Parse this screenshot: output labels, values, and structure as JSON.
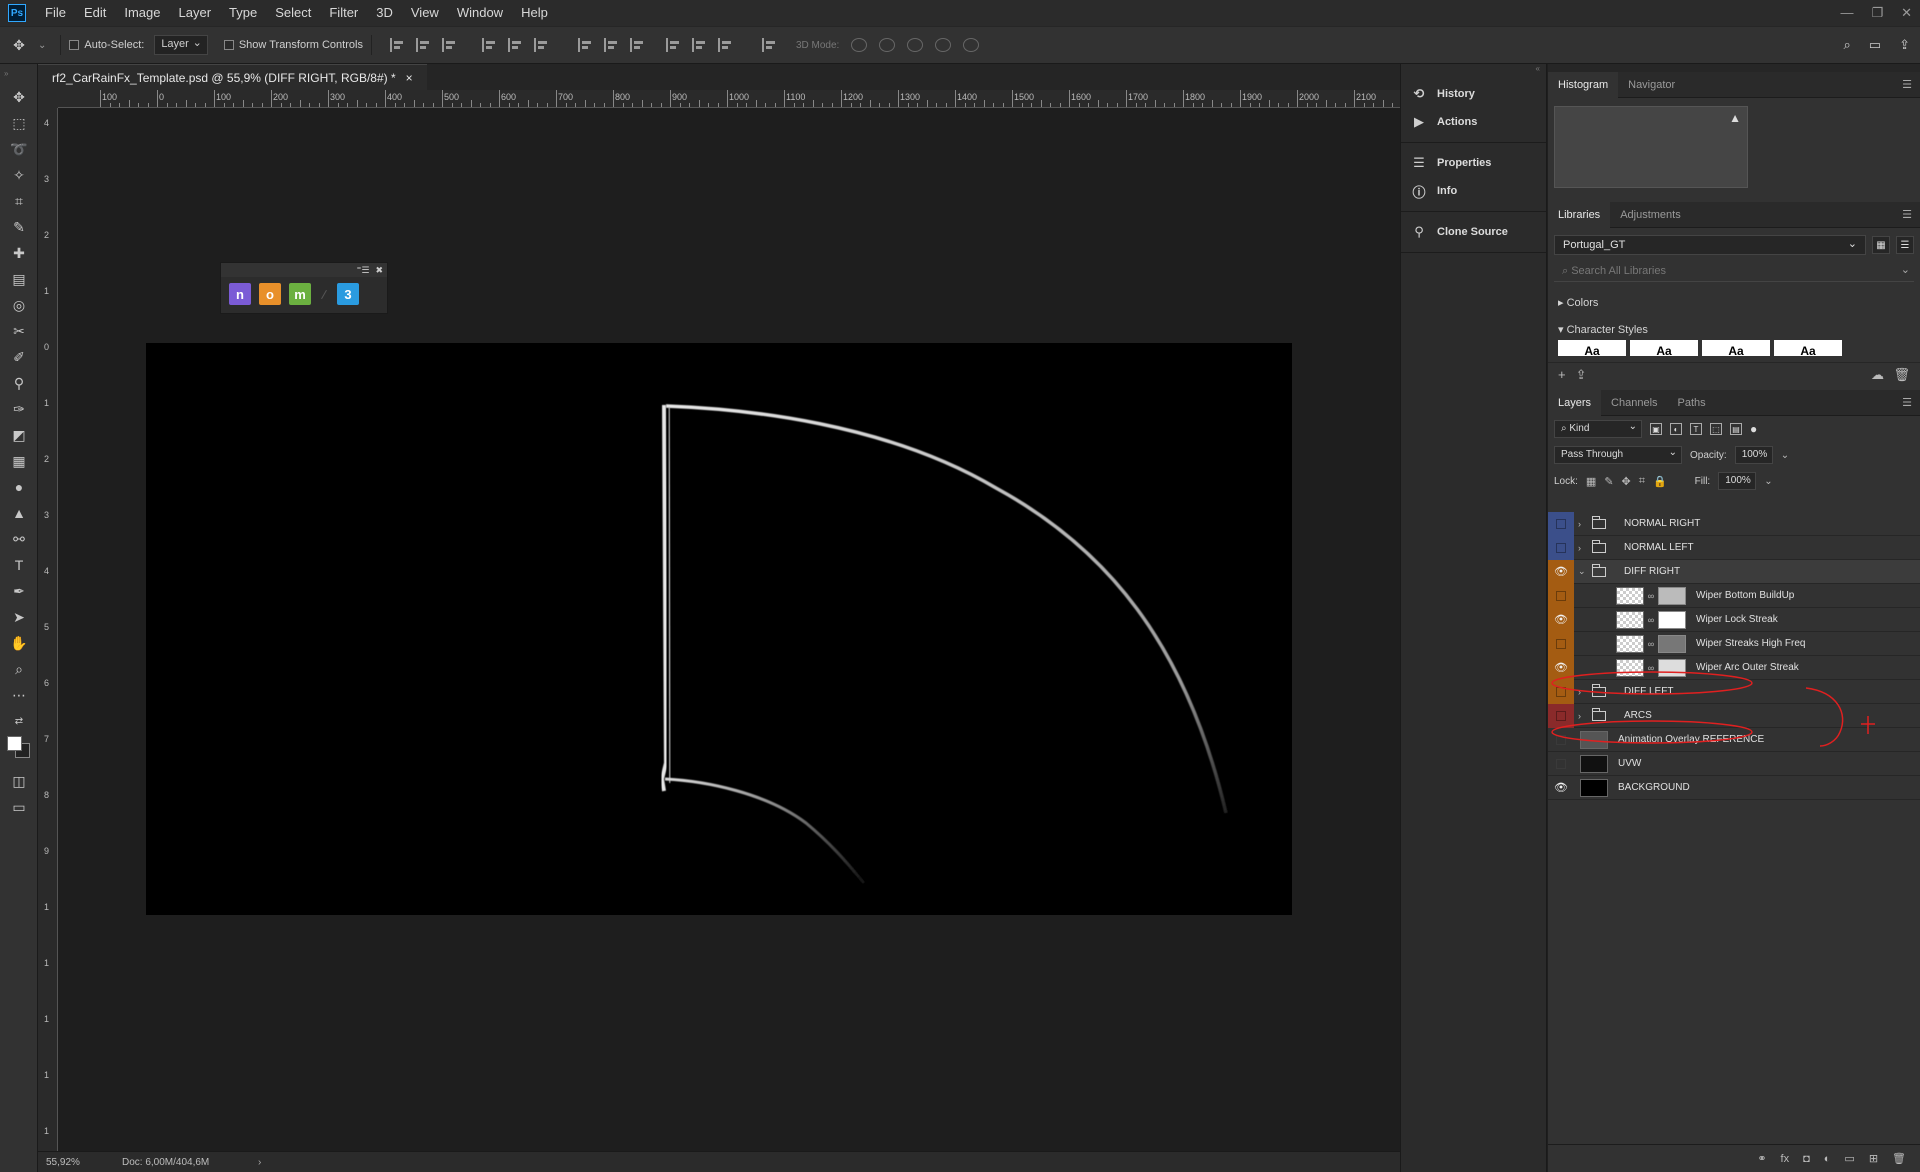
{
  "app": {
    "logo": "Ps"
  },
  "menu": [
    "File",
    "Edit",
    "Image",
    "Layer",
    "Type",
    "Select",
    "Filter",
    "3D",
    "View",
    "Window",
    "Help"
  ],
  "window_controls": [
    "—",
    "❐",
    "✕"
  ],
  "options": {
    "auto_select_label": "Auto-Select:",
    "auto_select_value": "Layer",
    "transform_label": "Show Transform Controls",
    "mode3d_label": "3D Mode:"
  },
  "document": {
    "tab_title": "rf2_CarRainFx_Template.psd @ 55,9% (DIFF RIGHT, RGB/8#) *",
    "close": "×",
    "ruler_top": [
      "100",
      "0",
      "100",
      "200",
      "300",
      "400",
      "500",
      "600",
      "700",
      "800",
      "900",
      "1000",
      "1100",
      "1200",
      "1300",
      "1400",
      "1500",
      "1600",
      "1700",
      "1800",
      "1900",
      "2000",
      "2100"
    ],
    "ruler_left": [
      "4",
      "3",
      "2",
      "1",
      "0",
      "1",
      "2",
      "3",
      "4",
      "5",
      "6",
      "7",
      "8",
      "9",
      "1",
      "1",
      "1",
      "1",
      "1"
    ]
  },
  "mini_panel": {
    "buttons": [
      {
        "label": "n",
        "color": "#7b5bd6"
      },
      {
        "label": "o",
        "color": "#e8902a"
      },
      {
        "label": "m",
        "color": "#6bb040"
      },
      {
        "label": "3",
        "color": "#2a9be0"
      }
    ]
  },
  "status": {
    "zoom": "55,92%",
    "doc": "Doc: 6,00M/404,6M",
    "arrow": "›"
  },
  "dock": {
    "groups": [
      [
        {
          "icon": "history-icon",
          "glyph": "⟲",
          "label": "History"
        },
        {
          "icon": "actions-icon",
          "glyph": "▶",
          "label": "Actions"
        }
      ],
      [
        {
          "icon": "properties-icon",
          "glyph": "☰",
          "label": "Properties"
        },
        {
          "icon": "info-icon",
          "glyph": "ⓘ",
          "label": "Info"
        }
      ],
      [
        {
          "icon": "clone-source-icon",
          "glyph": "⚲",
          "label": "Clone Source"
        }
      ]
    ]
  },
  "histogram_panel": {
    "tabs": [
      "Histogram",
      "Navigator"
    ],
    "warning": "▲"
  },
  "libraries_panel": {
    "tabs": [
      "Libraries",
      "Adjustments"
    ],
    "library": "Portugal_GT",
    "search_placeholder": "Search All Libraries",
    "section_colors": "Colors",
    "section_character_styles": "Character Styles",
    "thumb_text": "Aa"
  },
  "layers_panel": {
    "tabs": [
      "Layers",
      "Channels",
      "Paths"
    ],
    "kind": "Kind",
    "blend_mode": "Pass Through",
    "opacity_label": "Opacity:",
    "opacity_value": "100%",
    "lock_label": "Lock:",
    "fill_label": "Fill:",
    "fill_value": "100%",
    "layers": [
      {
        "name": "NORMAL RIGHT",
        "type": "group",
        "visible": false,
        "color": "#3b4f8a",
        "indent": 0
      },
      {
        "name": "NORMAL LEFT",
        "type": "group",
        "visible": false,
        "color": "#3b4f8a",
        "indent": 0
      },
      {
        "name": "DIFF RIGHT",
        "type": "group",
        "visible": true,
        "color": "#a45c12",
        "indent": 0,
        "open": true,
        "selected": true
      },
      {
        "name": "Wiper Bottom BuildUp",
        "type": "layer",
        "visible": false,
        "color": "#a45c12",
        "indent": 1,
        "mask": "#bbbbbb"
      },
      {
        "name": "Wiper Lock Streak",
        "type": "layer",
        "visible": true,
        "color": "#a45c12",
        "indent": 1,
        "mask": "#ffffff"
      },
      {
        "name": "Wiper Streaks High Freq",
        "type": "layer",
        "visible": false,
        "color": "#a45c12",
        "indent": 1,
        "mask": "#777777"
      },
      {
        "name": "Wiper Arc Outer Streak",
        "type": "layer",
        "visible": true,
        "color": "#a45c12",
        "indent": 1,
        "mask": "#dddddd"
      },
      {
        "name": "DIFF LEFT",
        "type": "group",
        "visible": false,
        "color": "#a45c12",
        "indent": 0
      },
      {
        "name": "ARCS",
        "type": "group",
        "visible": false,
        "color": "#8a2a2a",
        "indent": 0
      },
      {
        "name": "Animation Overlay REFERENCE",
        "type": "plain",
        "visible": false,
        "color": "",
        "indent": 0,
        "thumb": "#555555"
      },
      {
        "name": "UVW",
        "type": "plain",
        "visible": false,
        "color": "",
        "indent": 0,
        "thumb": "#111111"
      },
      {
        "name": "BACKGROUND",
        "type": "plain",
        "visible": true,
        "color": "",
        "indent": 0,
        "thumb": "#000000"
      }
    ]
  }
}
